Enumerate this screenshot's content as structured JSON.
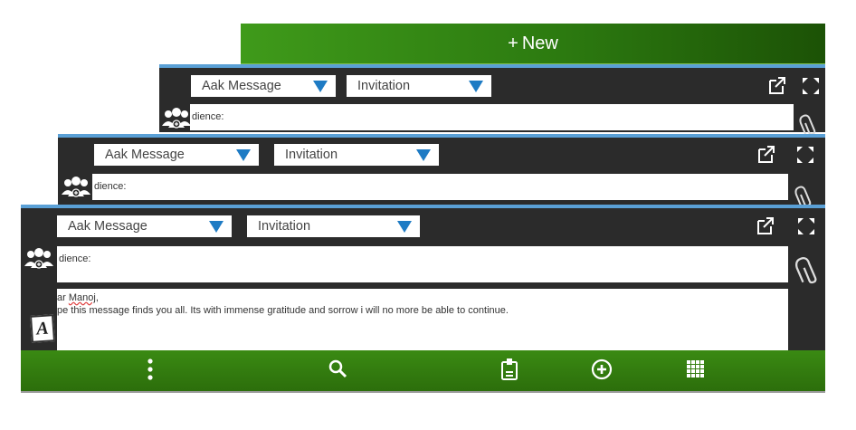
{
  "new_button": {
    "label": "New",
    "plus": "+"
  },
  "panels": [
    {
      "type_value": "Aak Message",
      "category_value": "Invitation",
      "audience_text": "dience:"
    },
    {
      "type_value": "Aak Message",
      "category_value": "Invitation",
      "audience_text": "dience:"
    },
    {
      "type_value": "Aak Message",
      "category_value": "Invitation",
      "audience_text": "dience:"
    }
  ],
  "message": {
    "greeting_prefix": "ar ",
    "greeting_name": "Manoj",
    "greeting_suffix": ",",
    "body": "pe this message finds you all. Its with immense gratitude and sorrow i will no more be able to continue."
  },
  "format_button": {
    "glyph": "A"
  },
  "colors": {
    "accent_blue": "#1e7bc4",
    "top_line": "#5aa0d6",
    "panel_dark": "#2b2b2b",
    "green_bar": "#2c7a10"
  },
  "icons": {
    "popout": "external-link-icon",
    "expand": "expand-icon",
    "attach": "paperclip-icon",
    "audience": "people-group-icon",
    "more": "vertical-dots-icon",
    "search": "search-icon",
    "clipboard": "clipboard-icon",
    "add": "plus-circle-icon",
    "grid": "grid-icon"
  }
}
